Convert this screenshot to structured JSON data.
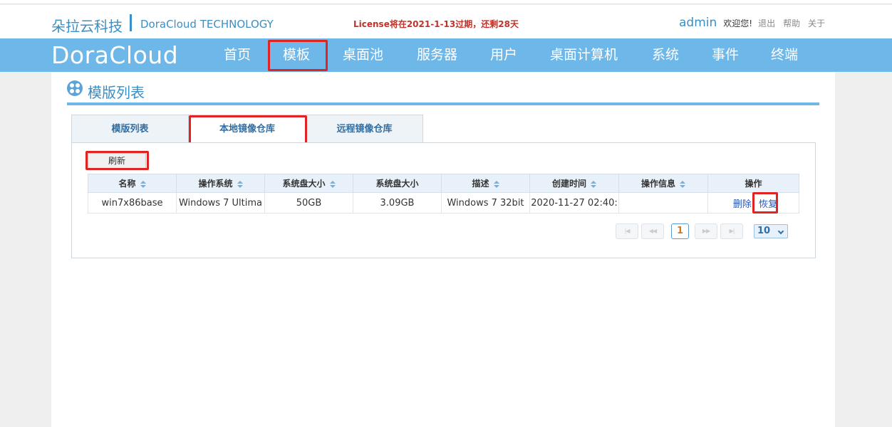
{
  "header": {
    "brand_cn": "朵拉云科技",
    "brand_en": "DoraCloud TECHNOLOGY",
    "license_notice": "License将在2021-1-13过期，还剩28天",
    "username": "admin",
    "welcome": "欢迎您!",
    "links": [
      "退出",
      "帮助",
      "关于"
    ]
  },
  "nav": {
    "logo": "DoraCloud",
    "items": [
      "首页",
      "模板",
      "桌面池",
      "服务器",
      "用户",
      "桌面计算机",
      "系统",
      "事件",
      "终端"
    ],
    "active": "模板"
  },
  "page": {
    "title": "模版列表",
    "tabs": [
      "模版列表",
      "本地镜像仓库",
      "远程镜像仓库"
    ],
    "active_tab": "本地镜像仓库",
    "refresh_label": "刷新"
  },
  "table": {
    "columns": [
      "名称",
      "操作系统",
      "系统盘大小",
      "系统盘大小",
      "描述",
      "创建时间",
      "操作信息",
      "操作"
    ],
    "rows": [
      {
        "name": "win7x86base",
        "os": "Windows 7 Ultima",
        "disk_size": "50GB",
        "disk_used": "3.09GB",
        "description": "Windows 7 32bit",
        "created": "2020-11-27 02:40:",
        "info": "",
        "actions": [
          "删除",
          "恢复"
        ]
      }
    ]
  },
  "pagination": {
    "current_page": "1",
    "page_size": "10"
  },
  "colors": {
    "nav_bg": "#6eb7e9",
    "brand": "#3a8fc6",
    "highlight": "#e02424",
    "license": "#c1332a"
  }
}
